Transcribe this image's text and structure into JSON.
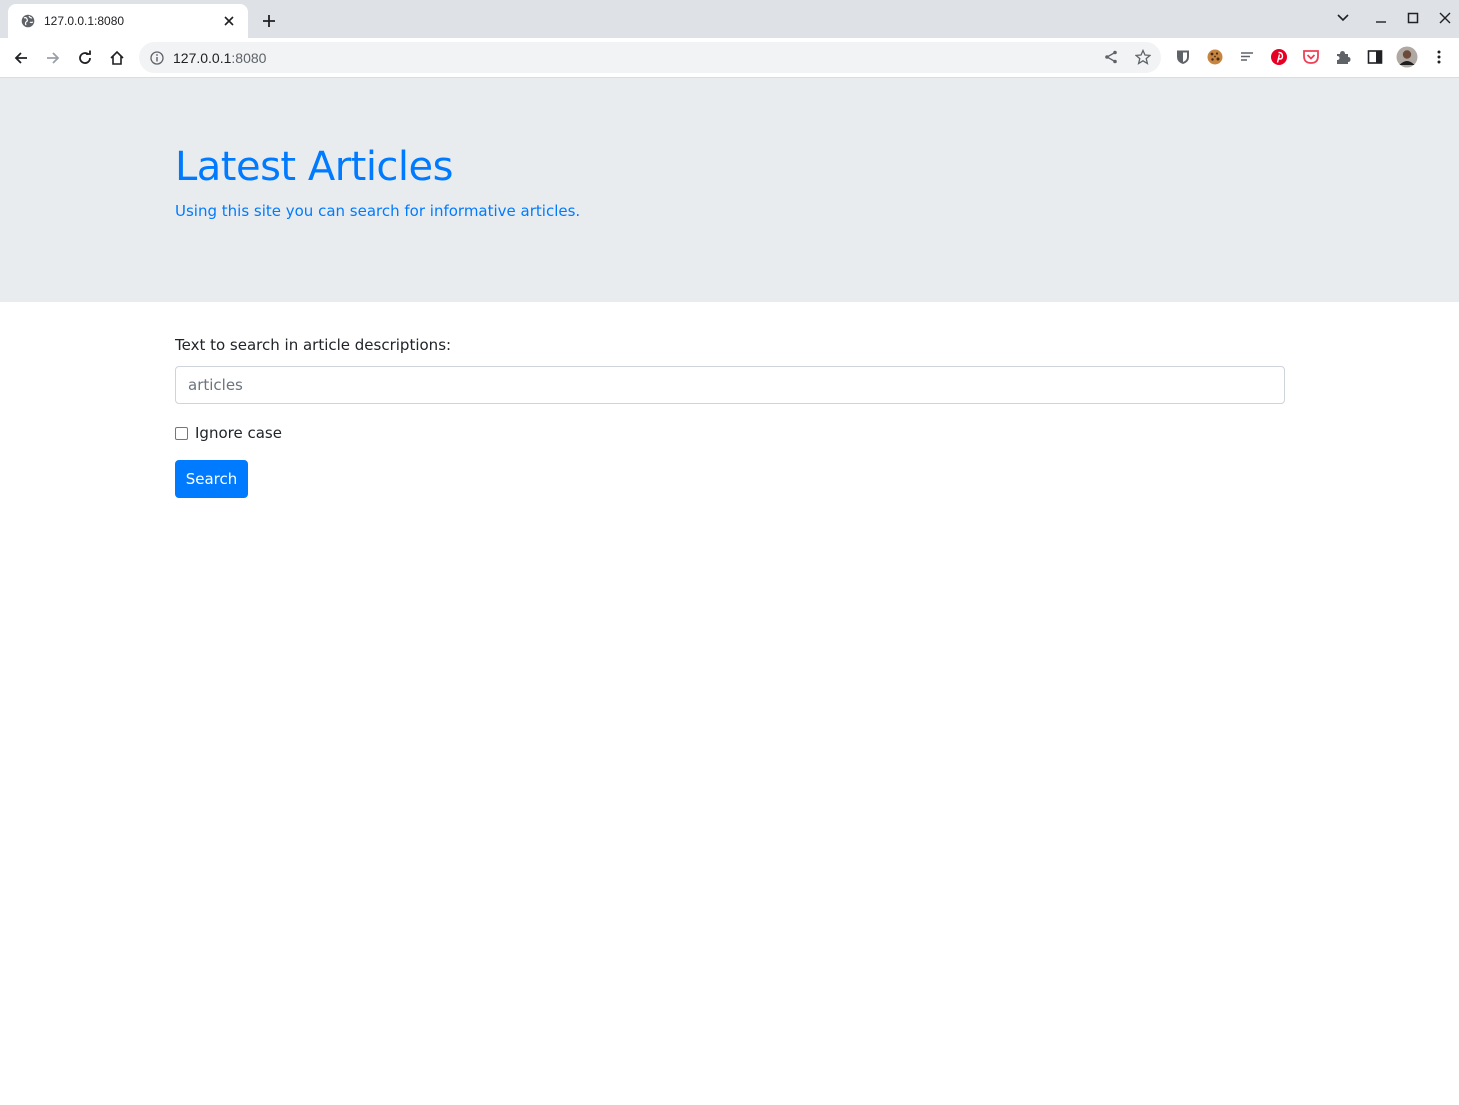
{
  "browser": {
    "tab_title": "127.0.0.1:8080",
    "url_host": "127.0.0.1",
    "url_port": ":8080",
    "icons": [
      "globe-icon",
      "close-icon",
      "plus-icon",
      "chevron-down-icon",
      "minimize-icon",
      "maximize-icon",
      "window-close-icon",
      "back-icon",
      "forward-icon",
      "reload-icon",
      "home-icon",
      "info-icon",
      "share-icon",
      "star-icon",
      "bitwarden-icon",
      "cookie-icon",
      "reader-icon",
      "pinterest-icon",
      "pocket-icon",
      "extensions-icon",
      "side-panel-icon",
      "avatar",
      "menu-icon"
    ]
  },
  "header": {
    "title": "Latest Articles",
    "subtitle": "Using this site you can search for informative articles."
  },
  "search": {
    "label": "Text to search in article descriptions:",
    "placeholder": "articles",
    "value": "",
    "ignore_case_label": "Ignore case",
    "ignore_case_checked": false,
    "button_label": "Search"
  },
  "colors": {
    "primary": "#007bff",
    "jumbotron": "#e9ecef"
  }
}
